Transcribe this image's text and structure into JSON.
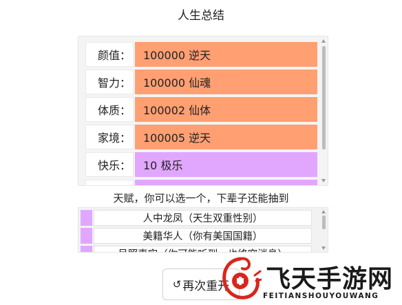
{
  "page": {
    "title": "人生总结"
  },
  "stats": [
    {
      "label": "颜值：",
      "value": "100000 逆天",
      "tier": "orange"
    },
    {
      "label": "智力：",
      "value": "100000 仙魂",
      "tier": "orange"
    },
    {
      "label": "体质：",
      "value": "100002 仙体",
      "tier": "orange"
    },
    {
      "label": "家境：",
      "value": "100005 逆天",
      "tier": "orange"
    },
    {
      "label": "快乐：",
      "value": "10 极乐",
      "tier": "purple"
    }
  ],
  "talents": {
    "heading": "天赋，你可以选一个，下辈子还能抽到",
    "items": [
      {
        "text": "人中龙凤（天生双重性别）"
      },
      {
        "text": "美籍华人（你有美国国籍）"
      },
      {
        "text": "吊照事实（你可能听到，也终究消息）"
      }
    ]
  },
  "restart": {
    "label": "再次重开",
    "icon": "refresh-icon"
  },
  "watermark": {
    "title": "飞天手游网",
    "subtitle": "FEITIANSHOUYOUWANG"
  },
  "colors": {
    "orange": "#ff9f72",
    "purple": "#e1a7ff",
    "logo_red": "#d9261c"
  }
}
